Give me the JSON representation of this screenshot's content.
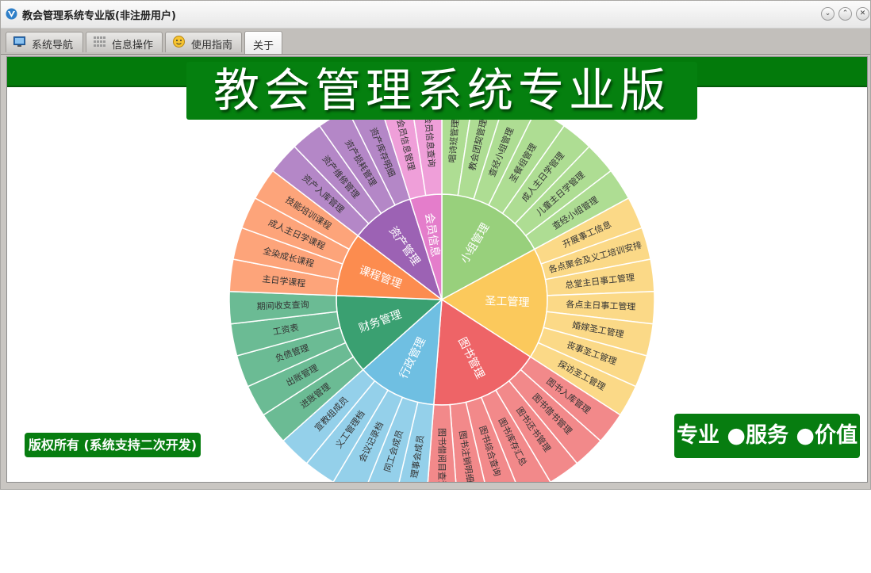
{
  "window": {
    "title": "教会管理系统专业版(非注册用户)",
    "controls": [
      "⌄",
      "⌃",
      "✕"
    ]
  },
  "tabs": [
    {
      "label": "系统导航",
      "icon": "monitor-icon"
    },
    {
      "label": "信息操作",
      "icon": "grid-icon"
    },
    {
      "label": "使用指南",
      "icon": "help-face-icon"
    },
    {
      "label": "关于",
      "icon": "",
      "active": true
    }
  ],
  "about": {
    "banner_title": "教会管理系统专业版",
    "copyright": "版权所有 (系统支持二次开发)",
    "slogan": "专业 ●服务 ●价值"
  },
  "colors": {
    "brand_green": "#077d10",
    "band_green": "#037a0b"
  },
  "chart_data": {
    "type": "sunburst",
    "categories": [
      {
        "name": "小组管理",
        "color": "#98d07c",
        "outer_color": "#aedd93",
        "children": [
          "唱诗班管理",
          "教会团契管理",
          "查经小组管理",
          "圣餐组管理",
          "成人主日学管理",
          "儿童主日学管理",
          "查经小组管理"
        ]
      },
      {
        "name": "圣工管理",
        "color": "#fbc95c",
        "outer_color": "#fbd987",
        "children": [
          "开展事工信息",
          "各点聚会及义工培训安排",
          "总堂主日事工管理",
          "各点主日事工管理",
          "婚嫁圣工管理",
          "丧事圣工管理",
          "探访圣工管理"
        ]
      },
      {
        "name": "图书管理",
        "color": "#ee6467",
        "outer_color": "#f2898a",
        "children": [
          "图书入库管理",
          "图书借书管理",
          "图书还书管理",
          "图书库存汇总",
          "图书综合查询",
          "图书注销明细",
          "图书借阅目查询"
        ]
      },
      {
        "name": "行政管理",
        "color": "#6fbfe2",
        "outer_color": "#94d0ea",
        "children": [
          "理事会成员",
          "同工会成员",
          "会议记录档",
          "义工管理档",
          "宣教组成员"
        ]
      },
      {
        "name": "财务管理",
        "color": "#3aa071",
        "outer_color": "#6bbb94",
        "children": [
          "进账管理",
          "出账管理",
          "负债管理",
          "工资表",
          "期间收支查询"
        ]
      },
      {
        "name": "课程管理",
        "color": "#fc8c4f",
        "outer_color": "#fda47a",
        "children": [
          "主日学课程",
          "全染成长课程",
          "成人主日学课程",
          "技能培训课程"
        ]
      },
      {
        "name": "资产管理",
        "color": "#9c62b4",
        "outer_color": "#b487c7",
        "children": [
          "资产入库管理",
          "资产维修管理",
          "资产损耗管理",
          "资产库存明细"
        ]
      },
      {
        "name": "会员信息",
        "color": "#e47dcb",
        "outer_color": "#ef9fd9",
        "children": [
          "会员信息管理",
          "会员信息查询"
        ]
      }
    ]
  }
}
